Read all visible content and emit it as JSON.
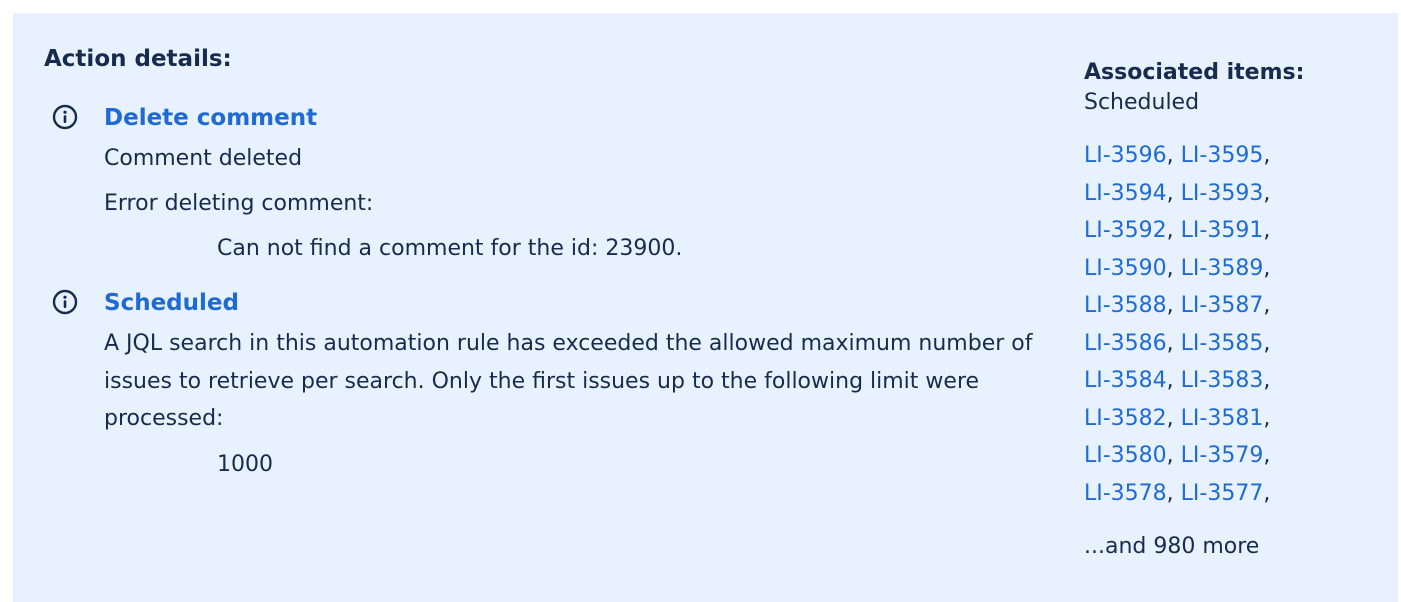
{
  "action_details": {
    "heading": "Action details:",
    "entries": [
      {
        "icon": "info-icon",
        "title": "Delete comment",
        "lines": [
          "Comment deleted",
          "Error deleting comment:"
        ],
        "indented": "Can not find a comment for the id: 23900."
      },
      {
        "icon": "info-icon",
        "title": "Scheduled",
        "paragraph": "A JQL search in this automation rule has exceeded the allowed maximum number of issues to retrieve per search. Only the first issues up to the following limit were processed:",
        "indented": "1000"
      }
    ]
  },
  "associated_items": {
    "heading": "Associated items:",
    "subheading": "Scheduled",
    "rows": [
      [
        "LI-3596",
        "LI-3595"
      ],
      [
        "LI-3594",
        "LI-3593"
      ],
      [
        "LI-3592",
        "LI-3591"
      ],
      [
        "LI-3590",
        "LI-3589"
      ],
      [
        "LI-3588",
        "LI-3587"
      ],
      [
        "LI-3586",
        "LI-3585"
      ],
      [
        "LI-3584",
        "LI-3583"
      ],
      [
        "LI-3582",
        "LI-3581"
      ],
      [
        "LI-3580",
        "LI-3579"
      ],
      [
        "LI-3578",
        "LI-3577"
      ]
    ],
    "separator": ", ",
    "trailing": ",",
    "more": "...and 980 more"
  },
  "colors": {
    "panel_background": "#e8f2fe",
    "link": "#1f6ad3",
    "text": "#172b4d"
  }
}
